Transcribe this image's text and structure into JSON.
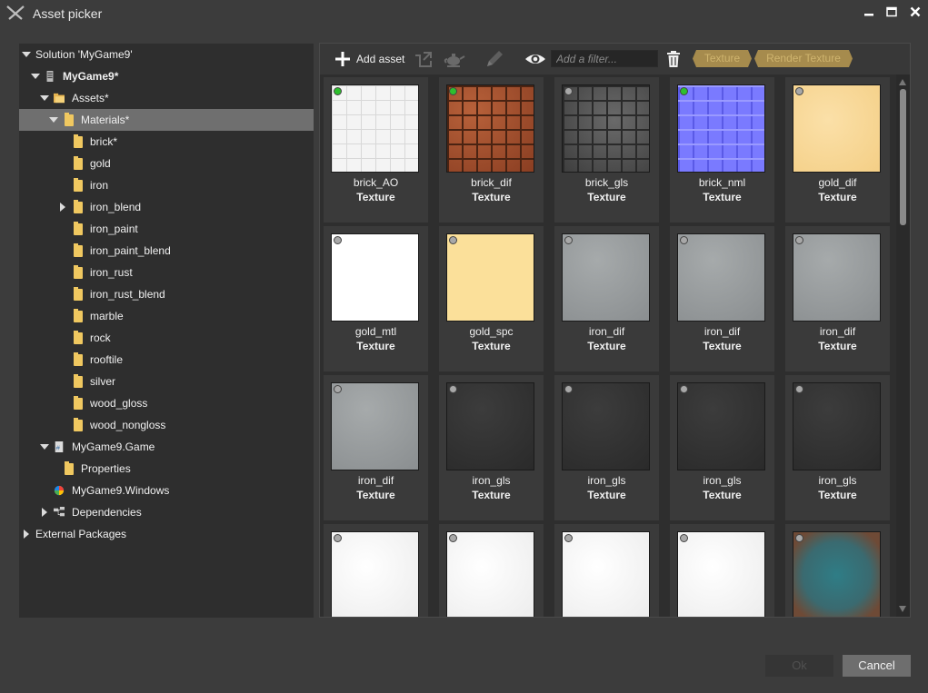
{
  "window": {
    "title": "Asset picker"
  },
  "tree": [
    {
      "label": "Solution 'MyGame9'",
      "indent": 0,
      "toggle": "down",
      "icon": "none",
      "bold": false,
      "selected": false
    },
    {
      "label": "MyGame9*",
      "indent": 1,
      "toggle": "down",
      "icon": "project-icon",
      "bold": true,
      "selected": false
    },
    {
      "label": "Assets*",
      "indent": 2,
      "toggle": "down",
      "icon": "folder-open-icon",
      "bold": false,
      "selected": false
    },
    {
      "label": "Materials*",
      "indent": 3,
      "toggle": "down",
      "icon": "folder-icon",
      "bold": false,
      "selected": true
    },
    {
      "label": "brick*",
      "indent": 4,
      "toggle": "none",
      "icon": "folder-icon",
      "bold": false,
      "selected": false
    },
    {
      "label": "gold",
      "indent": 4,
      "toggle": "none",
      "icon": "folder-icon",
      "bold": false,
      "selected": false
    },
    {
      "label": "iron",
      "indent": 4,
      "toggle": "none",
      "icon": "folder-icon",
      "bold": false,
      "selected": false
    },
    {
      "label": "iron_blend",
      "indent": 4,
      "toggle": "right",
      "icon": "folder-icon",
      "bold": false,
      "selected": false
    },
    {
      "label": "iron_paint",
      "indent": 4,
      "toggle": "none",
      "icon": "folder-icon",
      "bold": false,
      "selected": false
    },
    {
      "label": "iron_paint_blend",
      "indent": 4,
      "toggle": "none",
      "icon": "folder-icon",
      "bold": false,
      "selected": false
    },
    {
      "label": "iron_rust",
      "indent": 4,
      "toggle": "none",
      "icon": "folder-icon",
      "bold": false,
      "selected": false
    },
    {
      "label": "iron_rust_blend",
      "indent": 4,
      "toggle": "none",
      "icon": "folder-icon",
      "bold": false,
      "selected": false
    },
    {
      "label": "marble",
      "indent": 4,
      "toggle": "none",
      "icon": "folder-icon",
      "bold": false,
      "selected": false
    },
    {
      "label": "rock",
      "indent": 4,
      "toggle": "none",
      "icon": "folder-icon",
      "bold": false,
      "selected": false
    },
    {
      "label": "rooftile",
      "indent": 4,
      "toggle": "none",
      "icon": "folder-icon",
      "bold": false,
      "selected": false
    },
    {
      "label": "silver",
      "indent": 4,
      "toggle": "none",
      "icon": "folder-icon",
      "bold": false,
      "selected": false
    },
    {
      "label": "wood_gloss",
      "indent": 4,
      "toggle": "none",
      "icon": "folder-icon",
      "bold": false,
      "selected": false
    },
    {
      "label": "wood_nongloss",
      "indent": 4,
      "toggle": "none",
      "icon": "folder-icon",
      "bold": false,
      "selected": false
    },
    {
      "label": "MyGame9.Game",
      "indent": 2,
      "toggle": "down",
      "icon": "code-file-icon",
      "bold": false,
      "selected": false
    },
    {
      "label": "Properties",
      "indent": 3,
      "toggle": "none",
      "icon": "folder-icon",
      "bold": false,
      "selected": false
    },
    {
      "label": "MyGame9.Windows",
      "indent": 2,
      "toggle": "none",
      "icon": "windows-icon",
      "bold": false,
      "selected": false
    },
    {
      "label": "Dependencies",
      "indent": 2,
      "toggle": "right",
      "icon": "dependencies-icon",
      "bold": false,
      "selected": false
    },
    {
      "label": "External Packages",
      "indent": 0,
      "toggle": "right",
      "icon": "none",
      "bold": false,
      "selected": false
    }
  ],
  "toolbar": {
    "add_asset_label": "Add asset",
    "filter_placeholder": "Add a filter...",
    "tags": [
      "Texture",
      "Render Texture"
    ]
  },
  "assets": [
    {
      "name": "brick_AO",
      "type": "Texture",
      "status": "green",
      "thumb": "brick_ao"
    },
    {
      "name": "brick_dif",
      "type": "Texture",
      "status": "green",
      "thumb": "brick_dif"
    },
    {
      "name": "brick_gls",
      "type": "Texture",
      "status": "gray",
      "thumb": "brick_gls"
    },
    {
      "name": "brick_nml",
      "type": "Texture",
      "status": "green",
      "thumb": "brick_nml"
    },
    {
      "name": "gold_dif",
      "type": "Texture",
      "status": "gray",
      "thumb": "gold"
    },
    {
      "name": "gold_mtl",
      "type": "Texture",
      "status": "gray",
      "thumb": "white"
    },
    {
      "name": "gold_spc",
      "type": "Texture",
      "status": "gray",
      "thumb": "gold_flat"
    },
    {
      "name": "iron_dif",
      "type": "Texture",
      "status": "gray",
      "thumb": "iron_dif"
    },
    {
      "name": "iron_dif",
      "type": "Texture",
      "status": "gray",
      "thumb": "iron_dif"
    },
    {
      "name": "iron_dif",
      "type": "Texture",
      "status": "gray",
      "thumb": "iron_dif"
    },
    {
      "name": "iron_dif",
      "type": "Texture",
      "status": "gray",
      "thumb": "iron_dif"
    },
    {
      "name": "iron_gls",
      "type": "Texture",
      "status": "gray",
      "thumb": "iron_gls"
    },
    {
      "name": "iron_gls",
      "type": "Texture",
      "status": "gray",
      "thumb": "iron_gls"
    },
    {
      "name": "iron_gls",
      "type": "Texture",
      "status": "gray",
      "thumb": "iron_gls"
    },
    {
      "name": "iron_gls",
      "type": "Texture",
      "status": "gray",
      "thumb": "iron_gls"
    },
    {
      "name": "",
      "type": "",
      "status": "gray",
      "thumb": "marble"
    },
    {
      "name": "",
      "type": "",
      "status": "gray",
      "thumb": "marble"
    },
    {
      "name": "",
      "type": "",
      "status": "gray",
      "thumb": "marble"
    },
    {
      "name": "",
      "type": "",
      "status": "gray",
      "thumb": "marble"
    },
    {
      "name": "",
      "type": "",
      "status": "gray",
      "thumb": "rust"
    }
  ],
  "buttons": {
    "ok": "Ok",
    "cancel": "Cancel"
  },
  "colors": {
    "status_green": "#2ec02e",
    "status_gray": "#a8a8a8",
    "tag": "#a68b4d",
    "selection": "#6f6f6f"
  }
}
